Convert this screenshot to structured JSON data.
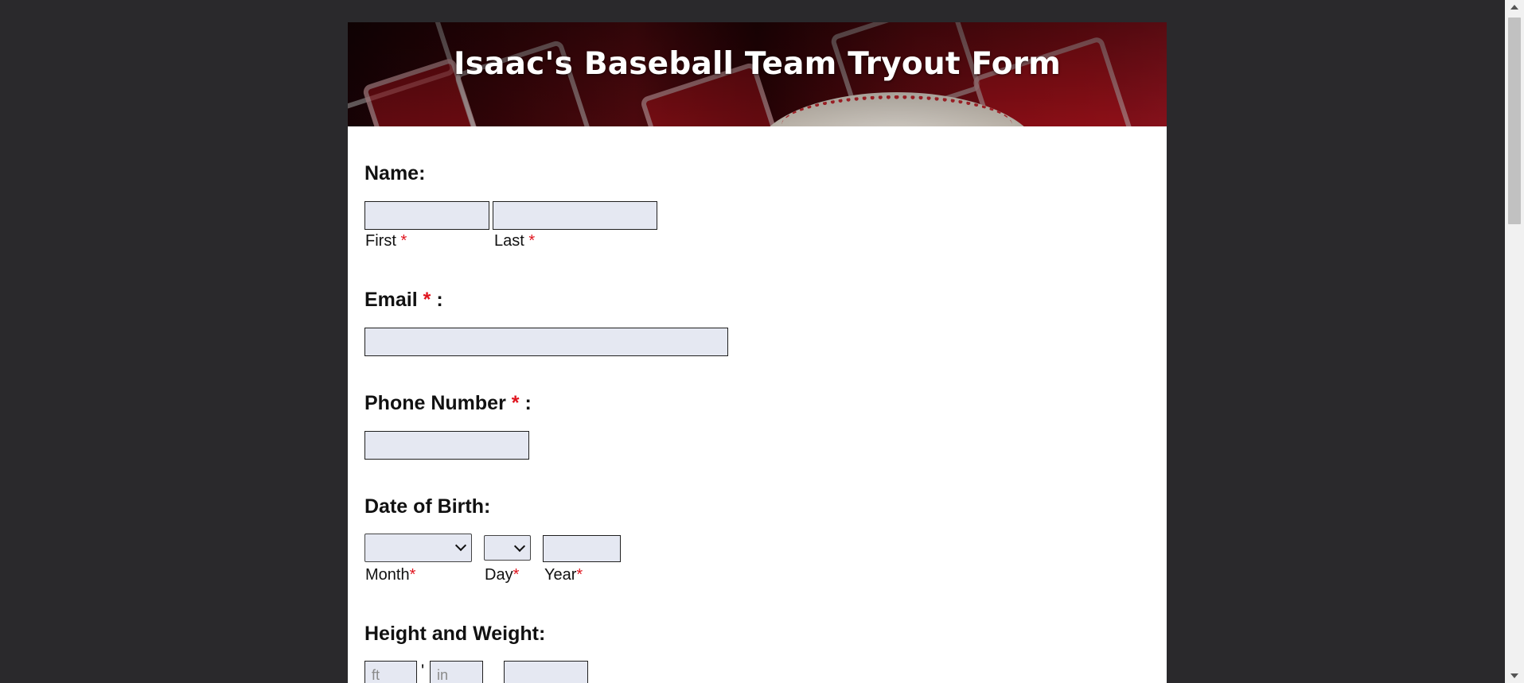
{
  "form": {
    "title": "Isaac's Baseball Team Tryout Form",
    "required_mark": "*",
    "name": {
      "label": "Name:",
      "first_label": "First",
      "last_label": "Last",
      "first_value": "",
      "last_value": ""
    },
    "email": {
      "label": "Email",
      "suffix": ":",
      "value": ""
    },
    "phone": {
      "label": "Phone Number",
      "suffix": ":",
      "value": ""
    },
    "dob": {
      "label": "Date of Birth:",
      "month_label": "Month",
      "day_label": "Day",
      "year_label": "Year",
      "month_value": "",
      "day_value": "",
      "year_value": ""
    },
    "height_weight": {
      "label": "Height and Weight:",
      "feet_placeholder": "ft",
      "feet_mark": "'",
      "inches_placeholder": "in",
      "weight_value": ""
    }
  },
  "colors": {
    "page_background": "#2a292c",
    "card_background": "#ffffff",
    "input_background": "#e5e8f2",
    "required_color": "#e0141e",
    "title_color": "#ffffff"
  }
}
